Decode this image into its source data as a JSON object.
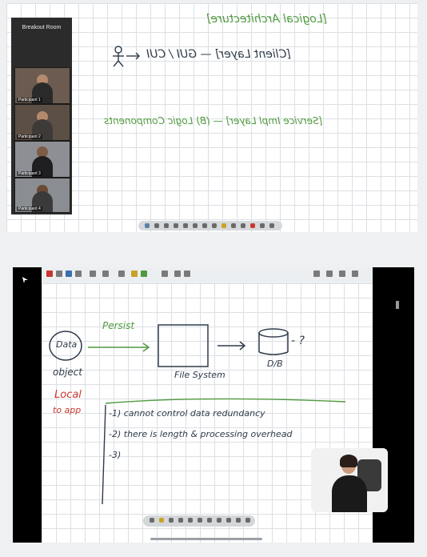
{
  "meeting": {
    "title": "Breakout Room",
    "participants": [
      "Participant 1",
      "Participant 2",
      "Participant 3",
      "Participant 4"
    ]
  },
  "top_board": {
    "line1": "[Logical Architecture]",
    "line2a": "[Client Layer] — GUI / CUI",
    "line3a": "[Service Impl Layer] — (B) Logic Components"
  },
  "bottom_board": {
    "data_label": "Data",
    "object_label": "object",
    "local_label": "Local",
    "app_label": "to app",
    "persist_label": "Persist",
    "fs_label": "File System",
    "db_label": "D/B",
    "db_question": "- ?",
    "point1": "-1) cannot control data redundancy",
    "point2": "-2) there is length & processing overhead",
    "point3": "-3)"
  },
  "colors": {
    "ink_green": "#4f9a3f",
    "ink_red": "#c8372d",
    "ink_dark": "#2f3b4a"
  }
}
